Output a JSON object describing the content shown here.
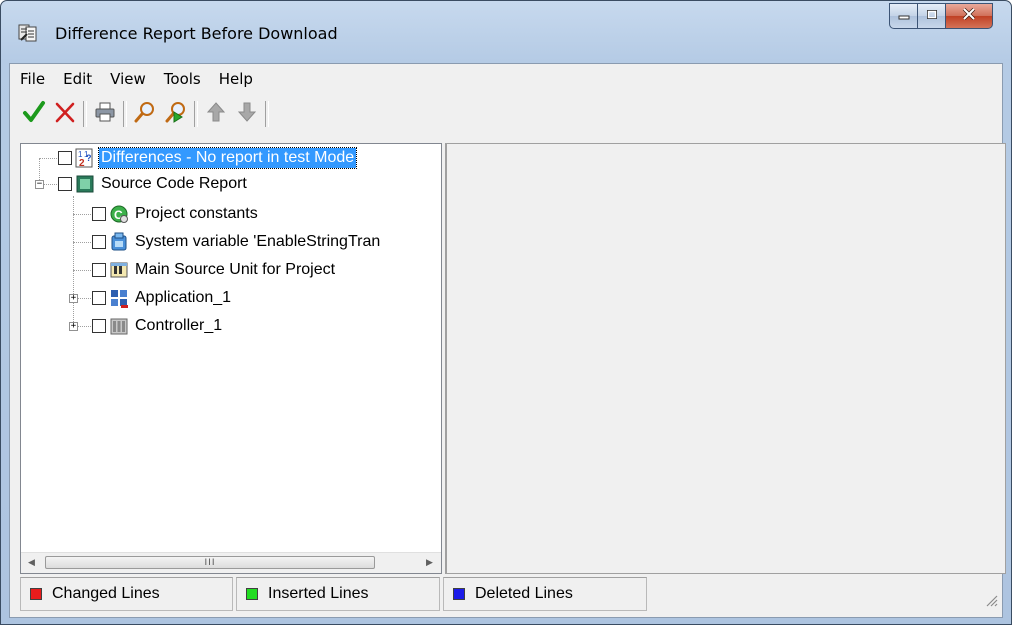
{
  "window": {
    "title": "Difference Report Before Download",
    "caption_buttons": [
      "minimize",
      "maximize",
      "close"
    ]
  },
  "menu": [
    "File",
    "Edit",
    "View",
    "Tools",
    "Help"
  ],
  "toolbar": {
    "buttons": [
      "accept-check-icon",
      "reject-x-icon",
      "print-icon",
      "find-icon",
      "find-next-icon",
      "up-arrow-icon",
      "down-arrow-icon"
    ]
  },
  "tree": {
    "nodes": [
      {
        "label": "Differences - No report in test Mode",
        "icon": "differences-report-icon",
        "selected": true
      },
      {
        "label": "Source Code Report",
        "icon": "source-code-report-icon",
        "expanded": true
      },
      {
        "label": "Project constants",
        "icon": "constants-icon"
      },
      {
        "label": "System variable 'EnableStringTran",
        "icon": "system-variable-icon"
      },
      {
        "label": "Main Source Unit for Project",
        "icon": "source-unit-icon"
      },
      {
        "label": "Application_1",
        "icon": "application-icon",
        "expandable": true
      },
      {
        "label": "Controller_1",
        "icon": "controller-icon",
        "expandable": true
      }
    ],
    "scroll_thumb_glyph": "III"
  },
  "status": {
    "changed": {
      "label": "Changed Lines",
      "color": "#e81c1c"
    },
    "inserted": {
      "label": "Inserted Lines",
      "color": "#22dd22"
    },
    "deleted": {
      "label": "Deleted Lines",
      "color": "#1c1ce8"
    }
  }
}
